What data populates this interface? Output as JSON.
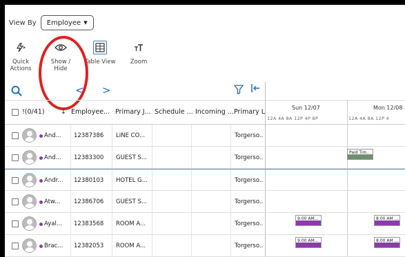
{
  "toolbar": {
    "viewby_label": "View By",
    "viewby_value": "Employee",
    "quick_actions": "Quick Actions",
    "show_hide": "Show / Hide",
    "table_view": "Table View",
    "zoom": "Zoom"
  },
  "nav": {
    "prev": "<",
    "next": ">"
  },
  "columns": {
    "count": "!(0/41)",
    "employee": "Employee...",
    "primary_job": "Primary J...",
    "schedule": "Schedule ...",
    "incoming": "Incoming ...",
    "primary_location": "Primary L..."
  },
  "calendar": {
    "days": [
      "Sun 12/07",
      "Mon 12/08"
    ],
    "hours": "12A  4A  8A  12P  4P  8P",
    "hours2": "12A  4A  8A  12P  4"
  },
  "rows": [
    {
      "name": "And...",
      "id": "12387386",
      "job": "LINE CO...",
      "loc": "Torgerso..."
    },
    {
      "name": "And...",
      "id": "12383300",
      "job": "GUEST S...",
      "loc": "Torgerso..."
    },
    {
      "name": "Andr...",
      "id": "12380103",
      "job": "HOTEL G...",
      "loc": "Torgerso..."
    },
    {
      "name": "Atw...",
      "id": "12386706",
      "job": "GUEST S...",
      "loc": "Torgerso..."
    },
    {
      "name": "Ayal...",
      "id": "12383568",
      "job": "ROOM A...",
      "loc": "Torgerso..."
    },
    {
      "name": "Brac...",
      "id": "12382053",
      "job": "ROOM A...",
      "loc": "Torgerso..."
    }
  ],
  "shifts": {
    "paid": "Paid Tim...",
    "s900": "9:00 AM...",
    "s800": "8:00 AM ..."
  },
  "colors": {
    "accent": "#1f6fb5",
    "paid": "#6d8f6d",
    "shift": "#8a3ca8",
    "highlight": "#e0201e"
  }
}
